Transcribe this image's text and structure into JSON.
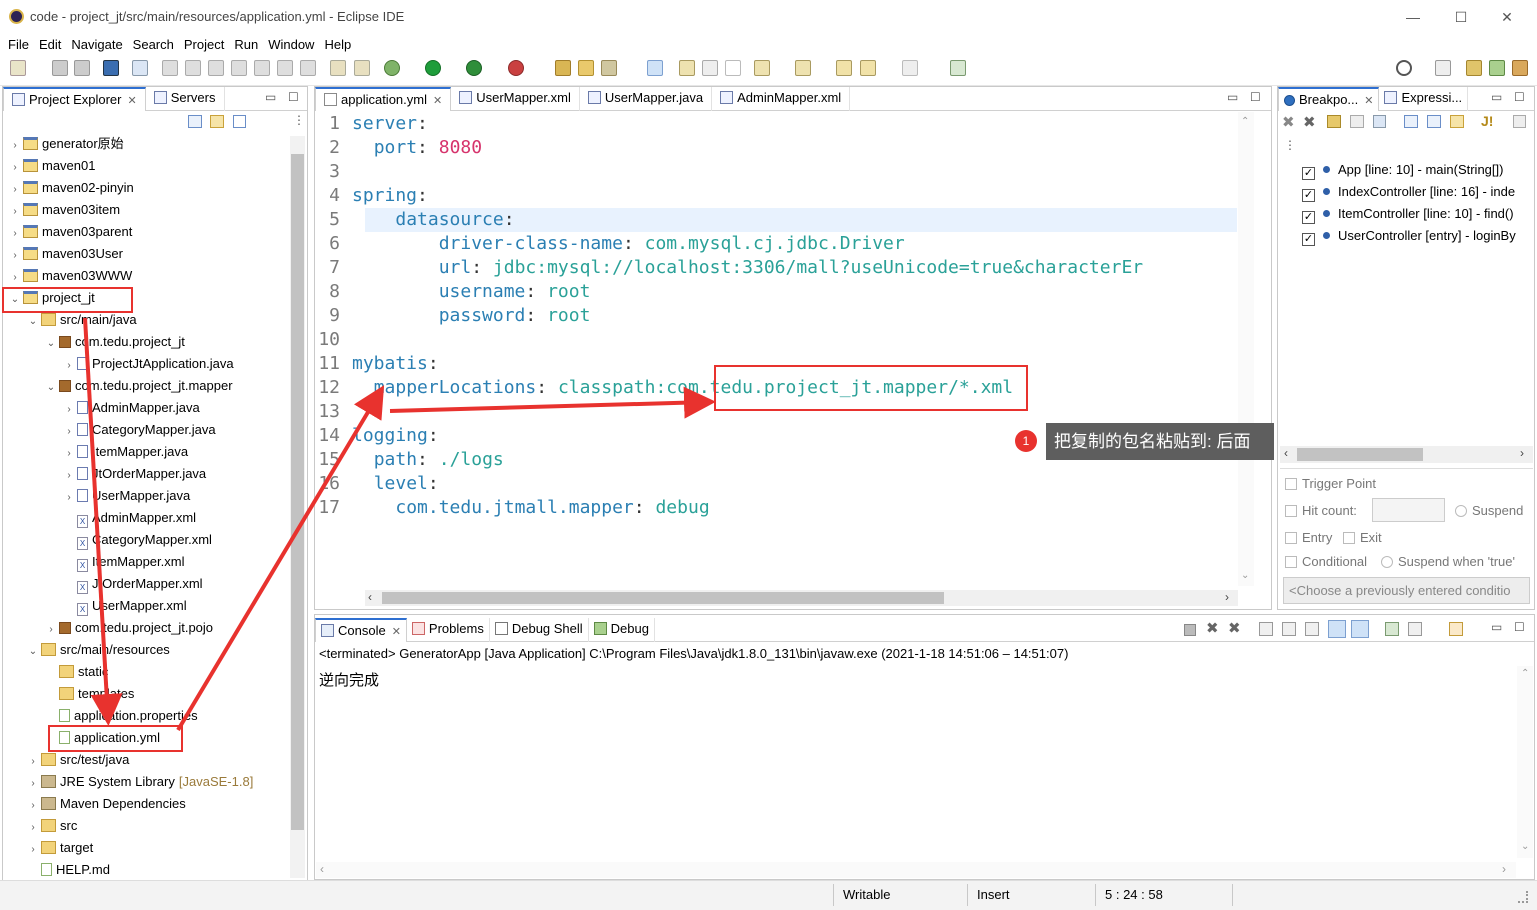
{
  "window": {
    "title": "code - project_jt/src/main/resources/application.yml - Eclipse IDE",
    "minimize": "—",
    "maximize": "☐",
    "close": "✕"
  },
  "menu": [
    "File",
    "Edit",
    "Navigate",
    "Search",
    "Project",
    "Run",
    "Window",
    "Help"
  ],
  "left_panel": {
    "tabs": [
      "Project Explorer",
      "Servers"
    ],
    "tree": [
      {
        "label": "generator原始",
        "level": 0,
        "icon": "project",
        "twisty": "›"
      },
      {
        "label": "maven01",
        "level": 0,
        "icon": "project",
        "twisty": "›"
      },
      {
        "label": "maven02-pinyin",
        "level": 0,
        "icon": "project",
        "twisty": "›"
      },
      {
        "label": "maven03item",
        "level": 0,
        "icon": "project",
        "twisty": "›"
      },
      {
        "label": "maven03parent",
        "level": 0,
        "icon": "project",
        "twisty": "›"
      },
      {
        "label": "maven03User",
        "level": 0,
        "icon": "project",
        "twisty": "›"
      },
      {
        "label": "maven03WWW",
        "level": 0,
        "icon": "project",
        "twisty": "›"
      },
      {
        "label": "project_jt",
        "level": 0,
        "icon": "project",
        "twisty": "⌄"
      },
      {
        "label": "src/main/java",
        "level": 1,
        "icon": "folder",
        "twisty": "⌄"
      },
      {
        "label": "com.tedu.project_jt",
        "level": 2,
        "icon": "package",
        "twisty": "⌄"
      },
      {
        "label": "ProjectJtApplication.java",
        "level": 3,
        "icon": "java",
        "twisty": "›"
      },
      {
        "label": "com.tedu.project_jt.mapper",
        "level": 2,
        "icon": "package",
        "twisty": "⌄"
      },
      {
        "label": "AdminMapper.java",
        "level": 3,
        "icon": "java",
        "twisty": "›"
      },
      {
        "label": "CategoryMapper.java",
        "level": 3,
        "icon": "java",
        "twisty": "›"
      },
      {
        "label": "ItemMapper.java",
        "level": 3,
        "icon": "java",
        "twisty": "›"
      },
      {
        "label": "JtOrderMapper.java",
        "level": 3,
        "icon": "java",
        "twisty": "›"
      },
      {
        "label": "UserMapper.java",
        "level": 3,
        "icon": "java",
        "twisty": "›"
      },
      {
        "label": "AdminMapper.xml",
        "level": 3,
        "icon": "xml",
        "twisty": ""
      },
      {
        "label": "CategoryMapper.xml",
        "level": 3,
        "icon": "xml",
        "twisty": ""
      },
      {
        "label": "ItemMapper.xml",
        "level": 3,
        "icon": "xml",
        "twisty": ""
      },
      {
        "label": "JtOrderMapper.xml",
        "level": 3,
        "icon": "xml",
        "twisty": ""
      },
      {
        "label": "UserMapper.xml",
        "level": 3,
        "icon": "xml",
        "twisty": ""
      },
      {
        "label": "com.tedu.project_jt.pojo",
        "level": 2,
        "icon": "package",
        "twisty": "›"
      },
      {
        "label": "src/main/resources",
        "level": 1,
        "icon": "folder",
        "twisty": "⌄"
      },
      {
        "label": "static",
        "level": 2,
        "icon": "folder",
        "twisty": ""
      },
      {
        "label": "templates",
        "level": 2,
        "icon": "folder",
        "twisty": ""
      },
      {
        "label": "application.properties",
        "level": 2,
        "icon": "file",
        "twisty": ""
      },
      {
        "label": "application.yml",
        "level": 2,
        "icon": "file",
        "twisty": ""
      },
      {
        "label": "src/test/java",
        "level": 1,
        "icon": "folder",
        "twisty": "›"
      },
      {
        "label": "JRE System Library",
        "level": 1,
        "icon": "library",
        "twisty": "›",
        "suffix": "[JavaSE-1.8]"
      },
      {
        "label": "Maven Dependencies",
        "level": 1,
        "icon": "library",
        "twisty": "›"
      },
      {
        "label": "src",
        "level": 1,
        "icon": "folder",
        "twisty": "›"
      },
      {
        "label": "target",
        "level": 1,
        "icon": "folder",
        "twisty": "›"
      },
      {
        "label": "HELP.md",
        "level": 1,
        "icon": "file",
        "twisty": ""
      }
    ]
  },
  "editor": {
    "tabs": [
      {
        "label": "application.yml",
        "closable": "✕"
      },
      {
        "label": "UserMapper.xml"
      },
      {
        "label": "UserMapper.java"
      },
      {
        "label": "AdminMapper.xml"
      }
    ],
    "lines": [
      {
        "n": "1",
        "key": "server",
        "sep": ":",
        "val": "",
        "indent": "",
        "valtype": ""
      },
      {
        "n": "2",
        "key": "port",
        "sep": ": ",
        "val": "8080",
        "indent": "  ",
        "valtype": "num"
      },
      {
        "n": "3",
        "key": "",
        "sep": "",
        "val": "",
        "indent": "",
        "valtype": ""
      },
      {
        "n": "4",
        "key": "spring",
        "sep": ":",
        "val": "",
        "indent": "",
        "valtype": ""
      },
      {
        "n": "5",
        "key": "datasource",
        "sep": ":",
        "val": "",
        "indent": "    ",
        "valtype": ""
      },
      {
        "n": "6",
        "key": "driver-class-name",
        "sep": ": ",
        "val": "com.mysql.cj.jdbc.Driver",
        "indent": "        ",
        "valtype": "str"
      },
      {
        "n": "7",
        "key": "url",
        "sep": ": ",
        "val": "jdbc:mysql://localhost:3306/mall?useUnicode=true&characterEr",
        "indent": "        ",
        "valtype": "str"
      },
      {
        "n": "8",
        "key": "username",
        "sep": ": ",
        "val": "root",
        "indent": "        ",
        "valtype": "str"
      },
      {
        "n": "9",
        "key": "password",
        "sep": ": ",
        "val": "root",
        "indent": "        ",
        "valtype": "str"
      },
      {
        "n": "10",
        "key": "",
        "sep": "",
        "val": "",
        "indent": "",
        "valtype": ""
      },
      {
        "n": "11",
        "key": "mybatis",
        "sep": ":",
        "val": "",
        "indent": "",
        "valtype": ""
      },
      {
        "n": "12",
        "key": "mapperLocations",
        "sep": ": ",
        "val": "classpath:com.tedu.project_jt.mapper/*.xml",
        "indent": "  ",
        "valtype": "str"
      },
      {
        "n": "13",
        "key": "",
        "sep": "",
        "val": "",
        "indent": "",
        "valtype": ""
      },
      {
        "n": "14",
        "key": "logging",
        "sep": ":",
        "val": "",
        "indent": "",
        "valtype": ""
      },
      {
        "n": "15",
        "key": "path",
        "sep": ": ",
        "val": "./logs",
        "indent": "  ",
        "valtype": "str"
      },
      {
        "n": "16",
        "key": "level",
        "sep": ":",
        "val": "",
        "indent": "  ",
        "valtype": ""
      },
      {
        "n": "17",
        "key": "com.tedu.jtmall.mapper",
        "sep": ": ",
        "val": "debug",
        "indent": "    ",
        "valtype": "str"
      }
    ],
    "callout": {
      "badge": "1",
      "text": "把复制的包名粘贴到: 后面"
    }
  },
  "right_panel": {
    "tabs": [
      "Breakpo...",
      "Expressi..."
    ],
    "breakpoints": [
      {
        "label": "App [line: 10] - main(String[])",
        "checked": "✓"
      },
      {
        "label": "IndexController [line: 16] - inde",
        "checked": "✓"
      },
      {
        "label": "ItemController [line: 10] - find()",
        "checked": "✓"
      },
      {
        "label": "UserController [entry] - loginBy",
        "checked": "✓"
      }
    ],
    "options": {
      "trigger_point": "Trigger Point",
      "hit_count": "Hit count:",
      "suspend": "Suspend",
      "entry": "Entry",
      "exit": "Exit",
      "conditional": "Conditional",
      "suspend_when_true": "Suspend when 'true'",
      "choose_condition": "<Choose a previously entered conditio"
    }
  },
  "console": {
    "tabs": [
      "Console",
      "Problems",
      "Debug Shell",
      "Debug"
    ],
    "terminated": "<terminated> GeneratorApp [Java Application] C:\\Program Files\\Java\\jdk1.8.0_131\\bin\\javaw.exe  (2021-1-18 14:51:06 – 14:51:07)",
    "output": "逆向完成"
  },
  "status": {
    "writable": "Writable",
    "insert": "Insert",
    "position": "5 : 24 : 58"
  },
  "colors": {
    "annotation_red": "#e8322e",
    "yaml_key": "#2b7fb3",
    "yaml_value": "#2aa198",
    "yaml_number": "#d6336c",
    "tab_accent": "#2e6fd1"
  }
}
